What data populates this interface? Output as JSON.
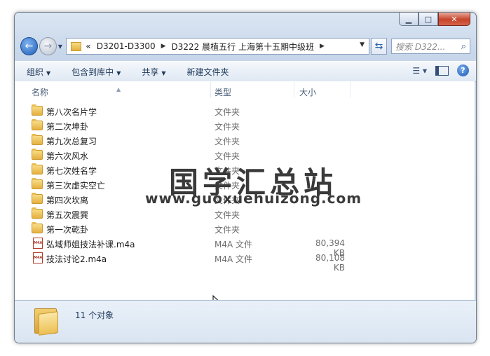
{
  "window": {
    "caption": {
      "minimize": "▁",
      "maximize": "□",
      "close": "✕"
    }
  },
  "nav": {
    "back_icon": "back-arrow-icon",
    "forward_icon": "forward-arrow-icon",
    "breadcrumbs": [
      "«",
      "D3201-D3300",
      "D3222 晨植五行  上海第十五期中级班"
    ],
    "search_placeholder": "搜索 D322..."
  },
  "toolbar": {
    "organize": "组织",
    "include_in_library": "包含到库中",
    "share": "共享",
    "new_folder": "新建文件夹"
  },
  "columns": {
    "name": "名称",
    "type": "类型",
    "size": "大小"
  },
  "files": [
    {
      "name": "第八次名片学",
      "type": "文件夹",
      "size": "",
      "kind": "folder"
    },
    {
      "name": "第二次坤卦",
      "type": "文件夹",
      "size": "",
      "kind": "folder"
    },
    {
      "name": "第九次总复习",
      "type": "文件夹",
      "size": "",
      "kind": "folder"
    },
    {
      "name": "第六次风水",
      "type": "文件夹",
      "size": "",
      "kind": "folder"
    },
    {
      "name": "第七次姓名学",
      "type": "文件夹",
      "size": "",
      "kind": "folder"
    },
    {
      "name": "第三次虚实空亡",
      "type": "文件夹",
      "size": "",
      "kind": "folder"
    },
    {
      "name": "第四次坎离",
      "type": "文件夹",
      "size": "",
      "kind": "folder"
    },
    {
      "name": "第五次震巽",
      "type": "文件夹",
      "size": "",
      "kind": "folder"
    },
    {
      "name": "第一次乾卦",
      "type": "文件夹",
      "size": "",
      "kind": "folder"
    },
    {
      "name": "弘域师姐技法补课.m4a",
      "type": "M4A 文件",
      "size": "80,394 KB",
      "kind": "m4a"
    },
    {
      "name": "技法讨论2.m4a",
      "type": "M4A 文件",
      "size": "80,108 KB",
      "kind": "m4a"
    }
  ],
  "watermark": {
    "title": "国学汇总站",
    "url": "www.guoxuehuizong.com"
  },
  "status": {
    "count": "11 个对象"
  }
}
